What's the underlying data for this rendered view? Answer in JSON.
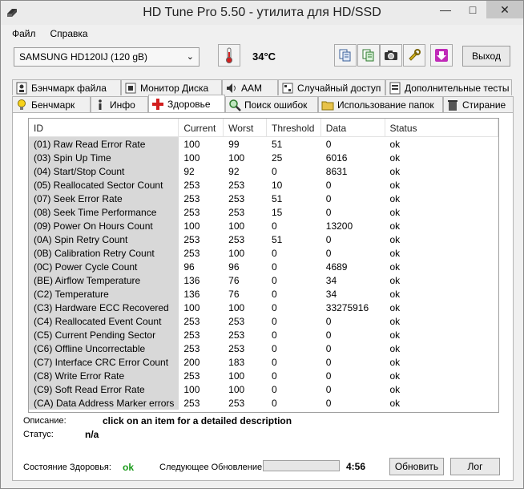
{
  "window": {
    "title": "HD Tune Pro 5.50 - утилита для HD/SSD"
  },
  "menu": [
    {
      "label": "Файл"
    },
    {
      "label": "Справка"
    }
  ],
  "toolbar": {
    "drive": "SAMSUNG HD120IJ (120 gB)",
    "temperature": "34°C",
    "exit_label": "Выход"
  },
  "tabs_top": [
    {
      "label": "Бэнчмарк файла",
      "icon": "file-benchmark-icon"
    },
    {
      "label": "Монитор Диска",
      "icon": "disk-monitor-icon"
    },
    {
      "label": "AAM",
      "icon": "speaker-icon"
    },
    {
      "label": "Случайный доступ",
      "icon": "random-access-icon"
    },
    {
      "label": "Дополнительные  тесты",
      "icon": "extra-tests-icon"
    }
  ],
  "tabs_bottom": [
    {
      "label": "Бенчмарк",
      "icon": "lightbulb-icon"
    },
    {
      "label": "Инфо",
      "icon": "info-icon"
    },
    {
      "label": "Здоровье",
      "icon": "health-cross-icon"
    },
    {
      "label": "Поиск ошибок",
      "icon": "magnifier-icon"
    },
    {
      "label": "Использование папок",
      "icon": "folder-icon"
    },
    {
      "label": "Стирание",
      "icon": "trash-icon"
    }
  ],
  "table": {
    "columns": [
      "ID",
      "Current",
      "Worst",
      "Threshold",
      "Data",
      "Status"
    ],
    "rows": [
      [
        "(01) Raw Read Error Rate",
        "100",
        "99",
        "51",
        "0",
        "ok"
      ],
      [
        "(03) Spin Up Time",
        "100",
        "100",
        "25",
        "6016",
        "ok"
      ],
      [
        "(04) Start/Stop Count",
        "92",
        "92",
        "0",
        "8631",
        "ok"
      ],
      [
        "(05) Reallocated Sector Count",
        "253",
        "253",
        "10",
        "0",
        "ok"
      ],
      [
        "(07) Seek Error Rate",
        "253",
        "253",
        "51",
        "0",
        "ok"
      ],
      [
        "(08) Seek Time Performance",
        "253",
        "253",
        "15",
        "0",
        "ok"
      ],
      [
        "(09) Power On Hours Count",
        "100",
        "100",
        "0",
        "13200",
        "ok"
      ],
      [
        "(0A) Spin Retry Count",
        "253",
        "253",
        "51",
        "0",
        "ok"
      ],
      [
        "(0B) Calibration Retry Count",
        "253",
        "100",
        "0",
        "0",
        "ok"
      ],
      [
        "(0C) Power Cycle Count",
        "96",
        "96",
        "0",
        "4689",
        "ok"
      ],
      [
        "(BE) Airflow Temperature",
        "136",
        "76",
        "0",
        "34",
        "ok"
      ],
      [
        "(C2) Temperature",
        "136",
        "76",
        "0",
        "34",
        "ok"
      ],
      [
        "(C3) Hardware ECC Recovered",
        "100",
        "100",
        "0",
        "33275916",
        "ok"
      ],
      [
        "(C4) Reallocated Event Count",
        "253",
        "253",
        "0",
        "0",
        "ok"
      ],
      [
        "(C5) Current Pending Sector",
        "253",
        "253",
        "0",
        "0",
        "ok"
      ],
      [
        "(C6) Offline Uncorrectable",
        "253",
        "253",
        "0",
        "0",
        "ok"
      ],
      [
        "(C7) Interface CRC Error Count",
        "200",
        "183",
        "0",
        "0",
        "ok"
      ],
      [
        "(C8) Write Error Rate",
        "253",
        "100",
        "0",
        "0",
        "ok"
      ],
      [
        "(C9) Soft Read Error Rate",
        "100",
        "100",
        "0",
        "0",
        "ok"
      ],
      [
        "(CA) Data Address Marker errors",
        "253",
        "253",
        "0",
        "0",
        "ok"
      ]
    ]
  },
  "info": {
    "description_label": "Описание:",
    "description_value": "click on an item for a detailed description",
    "status_label": "Статус:",
    "status_value": "n/a"
  },
  "footer": {
    "health_label": "Состояние Здоровья:",
    "health_value": "ok",
    "next_update_label": "Следующее Обновление:",
    "progress_fraction": 0.0,
    "timer": "4:56",
    "refresh_label": "Обновить",
    "log_label": "Лог"
  },
  "colors": {
    "health_ok": "#1a9a1a",
    "health_cross": "#d21f1f",
    "exit_arrow": "#c02ab8"
  }
}
